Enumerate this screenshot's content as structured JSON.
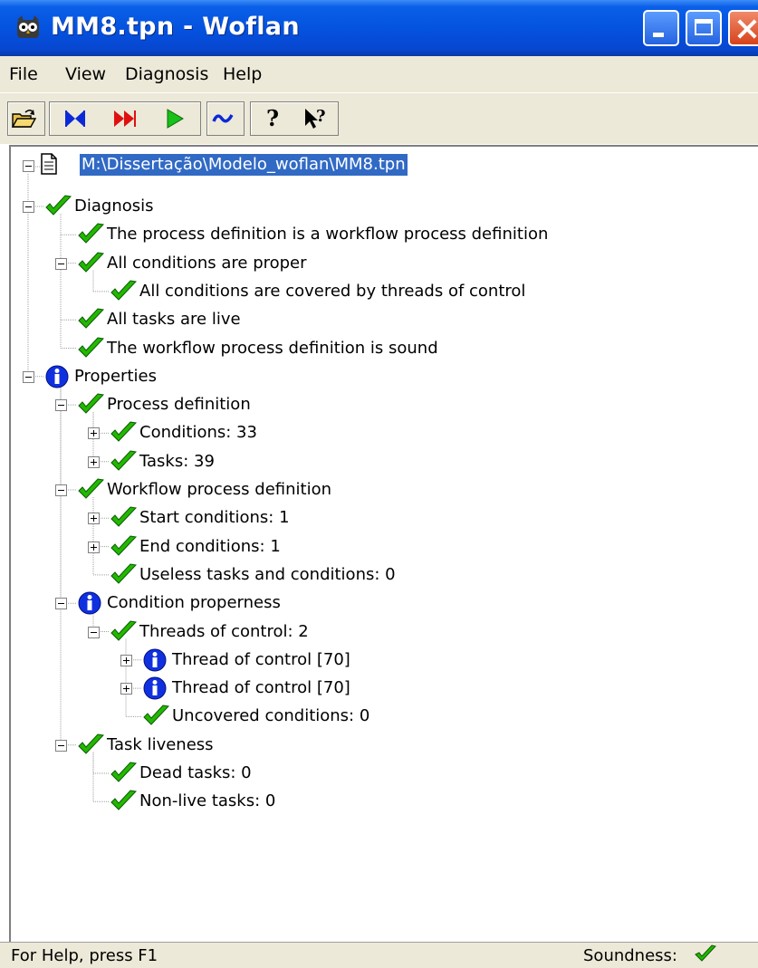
{
  "window": {
    "title": "MM8.tpn - Woflan",
    "icon": "woflan-owl-icon"
  },
  "menu": [
    "File",
    "View",
    "Diagnosis",
    "Help"
  ],
  "toolbar": {
    "buttons": [
      {
        "name": "open-icon"
      },
      {
        "name": "bowtie-icon"
      },
      {
        "name": "fast-forward-icon"
      },
      {
        "name": "play-icon"
      },
      {
        "name": "wave-icon"
      },
      {
        "name": "help-icon"
      },
      {
        "name": "context-help-icon"
      }
    ]
  },
  "tree": {
    "root": {
      "label": "M:\\Dissertação\\Modelo_woflan\\MM8.tpn",
      "selected": true
    },
    "nodes": [
      {
        "label": "Diagnosis",
        "icon": "check"
      },
      {
        "label": "The process definition is a workflow process definition",
        "icon": "check"
      },
      {
        "label": "All conditions are proper",
        "icon": "check"
      },
      {
        "label": "All conditions are covered by threads of control",
        "icon": "check"
      },
      {
        "label": "All tasks are live",
        "icon": "check"
      },
      {
        "label": "The workflow process definition is sound",
        "icon": "check"
      },
      {
        "label": "Properties",
        "icon": "info"
      },
      {
        "label": "Process definition",
        "icon": "check"
      },
      {
        "label": "Conditions: 33",
        "icon": "check"
      },
      {
        "label": "Tasks: 39",
        "icon": "check"
      },
      {
        "label": "Workflow process definition",
        "icon": "check"
      },
      {
        "label": "Start conditions: 1",
        "icon": "check"
      },
      {
        "label": "End conditions: 1",
        "icon": "check"
      },
      {
        "label": "Useless tasks and conditions: 0",
        "icon": "check"
      },
      {
        "label": "Condition properness",
        "icon": "info"
      },
      {
        "label": "Threads of control: 2",
        "icon": "check"
      },
      {
        "label": "Thread of control [70]",
        "icon": "info"
      },
      {
        "label": "Thread of control [70]",
        "icon": "info"
      },
      {
        "label": "Uncovered conditions: 0",
        "icon": "check"
      },
      {
        "label": "Task liveness",
        "icon": "check"
      },
      {
        "label": "Dead tasks: 0",
        "icon": "check"
      },
      {
        "label": "Non-live tasks: 0",
        "icon": "check"
      }
    ]
  },
  "status": {
    "help_text": "For Help, press F1",
    "soundness_label": "Soundness:",
    "soundness_icon": "check-icon"
  },
  "colors": {
    "selection": "#316ac5",
    "check_green": "#22b800",
    "info_blue": "#1030e0"
  }
}
